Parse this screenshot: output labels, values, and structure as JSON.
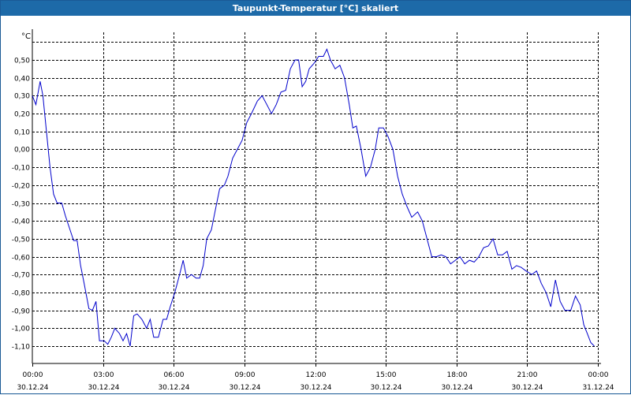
{
  "window": {
    "title": "Taupunkt-Temperatur [°C] skaliert"
  },
  "colors": {
    "titlebar": "#1d6aa8",
    "series": "#0000cc",
    "grid": "#000000"
  },
  "chart_data": {
    "type": "line",
    "title": "Taupunkt-Temperatur [°C] skaliert",
    "ylabel": "°C",
    "xlabel": "",
    "ylim": [
      -1.15,
      0.65
    ],
    "y_ticks": [
      0.5,
      0.4,
      0.3,
      0.2,
      0.1,
      0.0,
      -0.1,
      -0.2,
      -0.3,
      -0.4,
      -0.5,
      -0.6,
      -0.7,
      -0.8,
      -0.9,
      -1.0,
      -1.1
    ],
    "y_tick_labels": [
      "0,50",
      "0,40",
      "0,30",
      "0,20",
      "0,10",
      "0,00",
      "-0,10",
      "-0,20",
      "-0,30",
      "-0,40",
      "-0,50",
      "-0,60",
      "-0,70",
      "-0,80",
      "-0,90",
      "-1,00",
      "-1,10"
    ],
    "x_range_hours": [
      0,
      24
    ],
    "x_ticks": [
      {
        "hour": 0,
        "time": "00:00",
        "date": "30.12.24"
      },
      {
        "hour": 3,
        "time": "03:00",
        "date": "30.12.24"
      },
      {
        "hour": 6,
        "time": "06:00",
        "date": "30.12.24"
      },
      {
        "hour": 9,
        "time": "09:00",
        "date": "30.12.24"
      },
      {
        "hour": 12,
        "time": "12:00",
        "date": "30.12.24"
      },
      {
        "hour": 15,
        "time": "15:00",
        "date": "30.12.24"
      },
      {
        "hour": 18,
        "time": "18:00",
        "date": "30.12.24"
      },
      {
        "hour": 21,
        "time": "21:00",
        "date": "30.12.24"
      },
      {
        "hour": 24,
        "time": "00:00",
        "date": "31.12.24"
      }
    ],
    "grid": true,
    "series": [
      {
        "values": [
          [
            0.0,
            0.3
          ],
          [
            0.15,
            0.25
          ],
          [
            0.33,
            0.38
          ],
          [
            0.45,
            0.3
          ],
          [
            0.6,
            0.1
          ],
          [
            0.75,
            -0.1
          ],
          [
            0.9,
            -0.25
          ],
          [
            1.05,
            -0.3
          ],
          [
            1.25,
            -0.3
          ],
          [
            1.4,
            -0.37
          ],
          [
            1.6,
            -0.45
          ],
          [
            1.75,
            -0.51
          ],
          [
            1.9,
            -0.51
          ],
          [
            2.05,
            -0.65
          ],
          [
            2.2,
            -0.75
          ],
          [
            2.4,
            -0.89
          ],
          [
            2.55,
            -0.9
          ],
          [
            2.7,
            -0.85
          ],
          [
            2.85,
            -1.07
          ],
          [
            3.05,
            -1.07
          ],
          [
            3.2,
            -1.09
          ],
          [
            3.35,
            -1.05
          ],
          [
            3.5,
            -1.0
          ],
          [
            3.7,
            -1.03
          ],
          [
            3.85,
            -1.07
          ],
          [
            4.0,
            -1.03
          ],
          [
            4.15,
            -1.1
          ],
          [
            4.3,
            -0.93
          ],
          [
            4.45,
            -0.92
          ],
          [
            4.65,
            -0.95
          ],
          [
            4.85,
            -1.0
          ],
          [
            5.0,
            -0.95
          ],
          [
            5.15,
            -1.05
          ],
          [
            5.35,
            -1.05
          ],
          [
            5.55,
            -0.95
          ],
          [
            5.7,
            -0.95
          ],
          [
            5.85,
            -0.88
          ],
          [
            6.05,
            -0.8
          ],
          [
            6.25,
            -0.7
          ],
          [
            6.4,
            -0.62
          ],
          [
            6.55,
            -0.72
          ],
          [
            6.75,
            -0.7
          ],
          [
            6.95,
            -0.72
          ],
          [
            7.1,
            -0.72
          ],
          [
            7.25,
            -0.65
          ],
          [
            7.4,
            -0.5
          ],
          [
            7.6,
            -0.45
          ],
          [
            7.75,
            -0.35
          ],
          [
            7.95,
            -0.22
          ],
          [
            8.15,
            -0.2
          ],
          [
            8.3,
            -0.15
          ],
          [
            8.5,
            -0.05
          ],
          [
            8.7,
            0.0
          ],
          [
            8.9,
            0.05
          ],
          [
            9.1,
            0.15
          ],
          [
            9.3,
            0.2
          ],
          [
            9.55,
            0.27
          ],
          [
            9.75,
            0.3
          ],
          [
            9.95,
            0.25
          ],
          [
            10.15,
            0.2
          ],
          [
            10.35,
            0.25
          ],
          [
            10.55,
            0.32
          ],
          [
            10.75,
            0.33
          ],
          [
            10.95,
            0.45
          ],
          [
            11.15,
            0.5
          ],
          [
            11.3,
            0.5
          ],
          [
            11.45,
            0.35
          ],
          [
            11.6,
            0.38
          ],
          [
            11.75,
            0.45
          ],
          [
            11.95,
            0.48
          ],
          [
            12.15,
            0.52
          ],
          [
            12.35,
            0.52
          ],
          [
            12.5,
            0.56
          ],
          [
            12.65,
            0.5
          ],
          [
            12.85,
            0.45
          ],
          [
            13.05,
            0.47
          ],
          [
            13.25,
            0.4
          ],
          [
            13.45,
            0.25
          ],
          [
            13.6,
            0.12
          ],
          [
            13.75,
            0.13
          ],
          [
            13.95,
            0.0
          ],
          [
            14.15,
            -0.15
          ],
          [
            14.35,
            -0.1
          ],
          [
            14.55,
            0.0
          ],
          [
            14.7,
            0.12
          ],
          [
            14.9,
            0.12
          ],
          [
            15.1,
            0.07
          ],
          [
            15.3,
            0.0
          ],
          [
            15.5,
            -0.15
          ],
          [
            15.7,
            -0.25
          ],
          [
            15.9,
            -0.32
          ],
          [
            16.1,
            -0.38
          ],
          [
            16.35,
            -0.35
          ],
          [
            16.55,
            -0.4
          ],
          [
            16.75,
            -0.5
          ],
          [
            16.95,
            -0.6
          ],
          [
            17.15,
            -0.6
          ],
          [
            17.35,
            -0.59
          ],
          [
            17.55,
            -0.6
          ],
          [
            17.75,
            -0.64
          ],
          [
            17.95,
            -0.62
          ],
          [
            18.15,
            -0.6
          ],
          [
            18.35,
            -0.64
          ],
          [
            18.55,
            -0.62
          ],
          [
            18.75,
            -0.63
          ],
          [
            18.95,
            -0.6
          ],
          [
            19.15,
            -0.55
          ],
          [
            19.35,
            -0.54
          ],
          [
            19.55,
            -0.5
          ],
          [
            19.75,
            -0.59
          ],
          [
            19.95,
            -0.59
          ],
          [
            20.15,
            -0.57
          ],
          [
            20.35,
            -0.67
          ],
          [
            20.55,
            -0.65
          ],
          [
            20.75,
            -0.66
          ],
          [
            20.95,
            -0.68
          ],
          [
            21.2,
            -0.7
          ],
          [
            21.4,
            -0.68
          ],
          [
            21.6,
            -0.75
          ],
          [
            21.8,
            -0.8
          ],
          [
            22.0,
            -0.88
          ],
          [
            22.2,
            -0.73
          ],
          [
            22.4,
            -0.85
          ],
          [
            22.6,
            -0.9
          ],
          [
            22.85,
            -0.9
          ],
          [
            23.05,
            -0.82
          ],
          [
            23.25,
            -0.87
          ],
          [
            23.4,
            -0.98
          ],
          [
            23.55,
            -1.03
          ],
          [
            23.7,
            -1.08
          ],
          [
            23.85,
            -1.1
          ]
        ]
      }
    ]
  }
}
